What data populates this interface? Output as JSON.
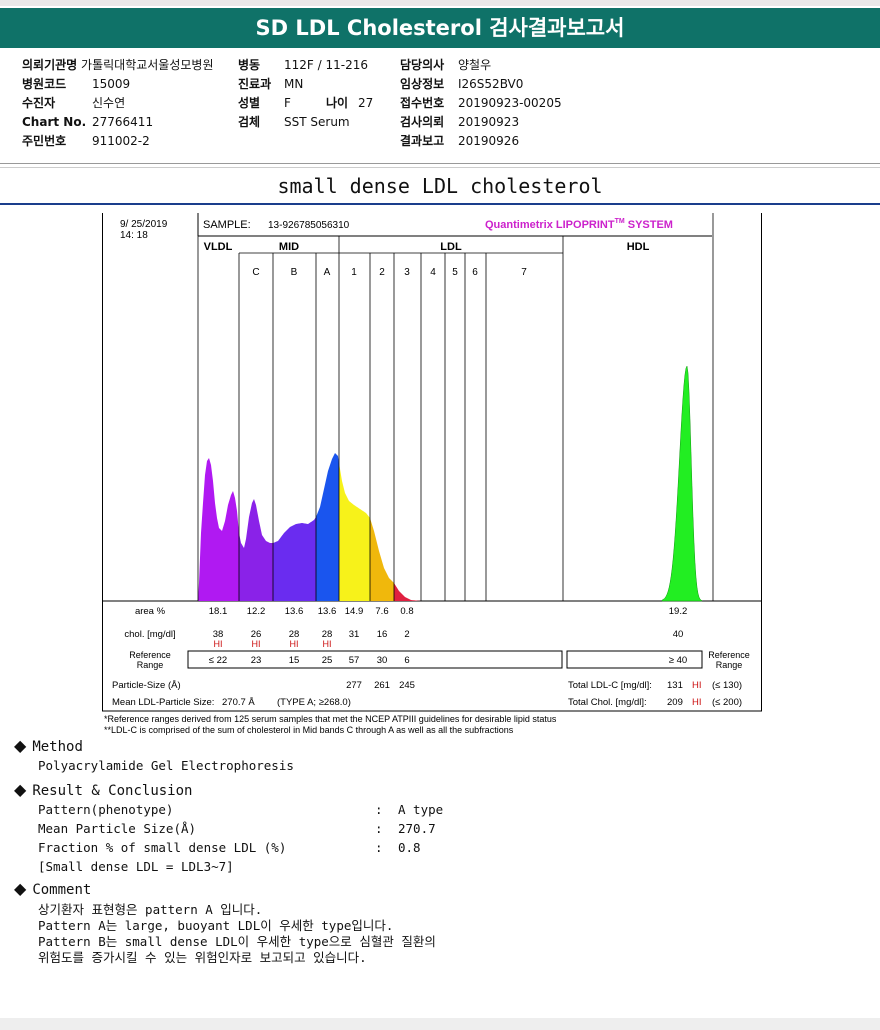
{
  "header": {
    "title": "SD LDL Cholesterol 검사결과보고서"
  },
  "info": {
    "col1": [
      {
        "label": "의뢰기관명",
        "value": "가톨릭대학교서울성모병원"
      },
      {
        "label": "병원코드",
        "value": "15009"
      },
      {
        "label": "수진자",
        "value": "신수연"
      },
      {
        "label": "Chart No.",
        "value": "27766411"
      },
      {
        "label": "주민번호",
        "value": "911002-2"
      }
    ],
    "col2": [
      {
        "label": "병동",
        "value": "112F / 11-216"
      },
      {
        "label": "진료과",
        "value": "MN"
      },
      {
        "label": "성별",
        "value": "F",
        "label2": "나이",
        "value2": "27"
      },
      {
        "label": "검체",
        "value": "SST Serum"
      }
    ],
    "col3": [
      {
        "label": "담당의사",
        "value": "양철우"
      },
      {
        "label": "임상정보",
        "value": "I26S52BV0"
      },
      {
        "label": "접수번호",
        "value": "20190923-00205"
      },
      {
        "label": "검사의뢰",
        "value": "20190923"
      },
      {
        "label": "결과보고",
        "value": "20190926"
      }
    ]
  },
  "subtitle": "small dense LDL cholesterol",
  "chart_data": {
    "type": "area",
    "date": "9/ 25/2019",
    "time": "14: 18",
    "sample_label": "SAMPLE:",
    "sample_id": "13-926785056310",
    "brand": "Quantimetrix LIPOPRINT",
    "brand_tm": "TM",
    "brand_suffix": " SYSTEM",
    "groups": [
      "VLDL",
      "MID",
      "LDL",
      "HDL"
    ],
    "bands": [
      "C",
      "B",
      "A",
      "1",
      "2",
      "3",
      "4",
      "5",
      "6",
      "7"
    ],
    "colors": {
      "vldl": "#b019f2",
      "c": "#8a22e8",
      "b": "#6a2cf0",
      "a": "#1a55ee",
      "ldl1": "#f7f21a",
      "ldl2": "#f0b80c",
      "ldl3": "#e02040",
      "hdl": "#22ee22",
      "hi": "#cc1111"
    },
    "rows": {
      "area_label": "area %",
      "area": [
        "18.1",
        "12.2",
        "13.6",
        "13.6",
        "14.9",
        "7.6",
        "0.8"
      ],
      "area_hdl": "19.2",
      "chol_label": "chol. [mg/dl]",
      "chol": [
        "38",
        "26",
        "28",
        "28",
        "31",
        "16",
        "2"
      ],
      "chol_hi": [
        "HI",
        "HI",
        "HI",
        "HI",
        "",
        "",
        ""
      ],
      "chol_hdl": "40",
      "ref_label": "Reference Range",
      "ref": [
        "≤  22",
        "23",
        "15",
        "25",
        "57",
        "30",
        "6"
      ],
      "ref_hdl": "≥ 40",
      "ref_label_right": "Reference Range",
      "psize_label": "Particle-Size (Å)",
      "psize": [
        "277",
        "261",
        "245"
      ],
      "mean_label": "Mean LDL-Particle Size:",
      "mean_value": "270.7 Å",
      "mean_type": "(TYPE A; ≥268.0)",
      "tldl_label": "Total LDL-C [mg/dl]:",
      "tldl_value": "131",
      "tldl_flag": "HI",
      "tldl_ref": "(≤ 130)",
      "tchol_label": "Total Chol. [mg/dl]:",
      "tchol_value": "209",
      "tchol_flag": "HI",
      "tchol_ref": "(≤ 200)"
    },
    "notes": [
      "*Reference ranges derived from 125 serum samples that met the NCEP ATPIII guidelines for desirable lipid status",
      "**LDL-C is comprised of the sum of cholesterol in Mid bands C through A as well as all the subfractions"
    ]
  },
  "method": {
    "heading": "Method",
    "text": "Polyacrylamide Gel Electrophoresis"
  },
  "result": {
    "heading": "Result & Conclusion",
    "rows": [
      {
        "k": "Pattern(phenotype)",
        "v": "A type"
      },
      {
        "k": "Mean Particle Size(Å)",
        "v": "270.7"
      },
      {
        "k": "Fraction % of small dense LDL (%)",
        "v": "0.8"
      }
    ],
    "note": "[Small dense LDL = LDL3~7]"
  },
  "comment": {
    "heading": "Comment",
    "lines": [
      "상기환자 표현형은 pattern A 입니다.",
      "Pattern A는 large, buoyant LDL이 우세한 type입니다.",
      "Pattern B는 small dense LDL이 우세한 type으로 심혈관 질환의",
      "위험도를 증가시킬 수 있는 위험인자로 보고되고 있습니다."
    ]
  }
}
